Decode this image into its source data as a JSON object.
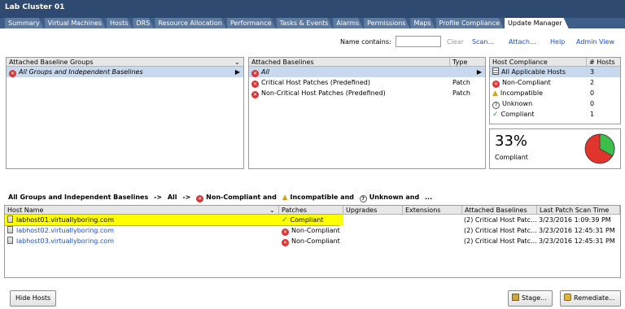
{
  "window": {
    "title": "Lab Cluster 01"
  },
  "tabs": [
    "Summary",
    "Virtual Machines",
    "Hosts",
    "DRS",
    "Resource Allocation",
    "Performance",
    "Tasks & Events",
    "Alarms",
    "Permissions",
    "Maps",
    "Profile Compliance",
    "Update Manager"
  ],
  "active_tab": "Update Manager",
  "toolbar": {
    "name_contains_label": "Name contains:",
    "name_contains_value": "",
    "clear": "Clear",
    "scan": "Scan...",
    "attach": "Attach...",
    "help": "Help",
    "admin_view": "Admin View"
  },
  "baseline_groups": {
    "header": "Attached Baseline Groups",
    "items": [
      "All Groups and Independent Baselines"
    ]
  },
  "baselines": {
    "header_name": "Attached Baselines",
    "header_type": "Type",
    "items": [
      {
        "name": "All",
        "type": ""
      },
      {
        "name": "Critical Host Patches (Predefined)",
        "type": "Patch"
      },
      {
        "name": "Non-Critical Host Patches (Predefined)",
        "type": "Patch"
      }
    ]
  },
  "compliance": {
    "header_name": "Host Compliance",
    "header_count": "# Hosts",
    "items": [
      {
        "label": "All Applicable Hosts",
        "count": "3",
        "icon": "applicable-icon"
      },
      {
        "label": "Non-Compliant",
        "count": "2",
        "icon": "error-icon"
      },
      {
        "label": "Incompatible",
        "count": "0",
        "icon": "warning-icon"
      },
      {
        "label": "Unknown",
        "count": "0",
        "icon": "unknown-icon"
      },
      {
        "label": "Compliant",
        "count": "1",
        "icon": "check-icon"
      }
    ],
    "percent": "33%",
    "percent_label": "Compliant",
    "compliant_fraction": 0.33,
    "colors": {
      "compliant": "#3bbf4a",
      "noncompliant": "#e0342c"
    }
  },
  "filter": {
    "part1": "All Groups and Independent Baselines",
    "arrow1": "->",
    "part2": "All",
    "arrow2": "->",
    "noncompliant": "Non-Compliant and",
    "incompatible": "Incompatible and",
    "unknown": "Unknown and",
    "ellipsis": "..."
  },
  "hosts_table": {
    "headers": [
      "Host Name",
      "Patches",
      "Upgrades",
      "Extensions",
      "Attached Baselines",
      "Last Patch Scan Time"
    ],
    "rows": [
      {
        "name": "labhost01.virtuallyboring.com",
        "patches": "Compliant",
        "status": "ok",
        "upgrades": "",
        "extensions": "",
        "baselines": "(2) Critical Host Patc...",
        "scan": "3/23/2016 1:09:39 PM"
      },
      {
        "name": "labhost02.virtuallyboring.com",
        "patches": "Non-Compliant",
        "status": "err",
        "upgrades": "",
        "extensions": "",
        "baselines": "(2) Critical Host Patc...",
        "scan": "3/23/2016 12:45:31 PM"
      },
      {
        "name": "labhost03.virtuallyboring.com",
        "patches": "Non-Compliant",
        "status": "err",
        "upgrades": "",
        "extensions": "",
        "baselines": "(2) Critical Host Patc...",
        "scan": "3/23/2016 12:45:31 PM"
      }
    ]
  },
  "buttons": {
    "hide_hosts": "Hide Hosts",
    "stage": "Stage...",
    "remediate": "Remediate..."
  },
  "highlight_color": "#ffff00"
}
